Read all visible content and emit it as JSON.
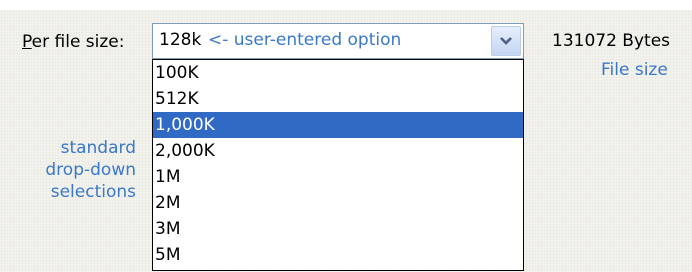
{
  "field": {
    "label_prefix": "",
    "label_mnemonic": "P",
    "label_rest": "er file size:"
  },
  "combo": {
    "value": "128k",
    "annotation": "<- user-entered option",
    "dropdown_icon": "chevron-down-icon"
  },
  "size_readout": {
    "bytes": "131072 Bytes",
    "caption": "File size"
  },
  "dropdown": {
    "options": [
      "100K",
      "512K",
      "1,000K",
      "2,000K",
      "1M",
      "2M",
      "3M",
      "5M"
    ],
    "selected_index": 2
  },
  "side_note": {
    "lines": [
      "standard",
      "drop-down",
      "selections"
    ]
  },
  "colors": {
    "annotation": "#3a78c9",
    "selection": "#316ac5",
    "panel": "#f3f2ec"
  }
}
